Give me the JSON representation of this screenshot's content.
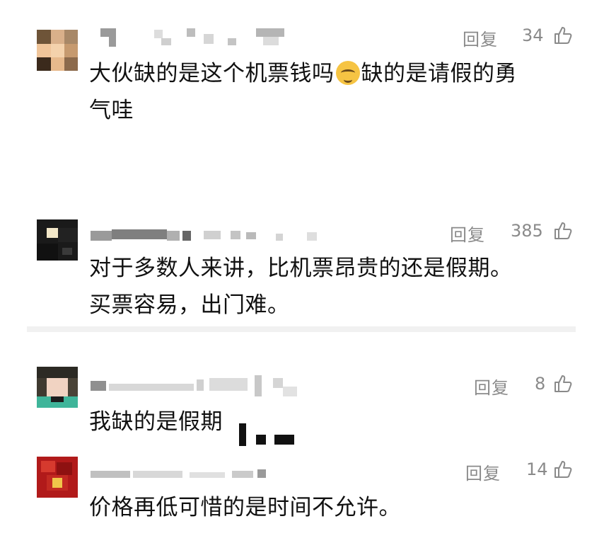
{
  "comments": [
    {
      "reply_label": "回复",
      "likes": "34",
      "lines": [
        "大伙缺的是这个机票钱吗",
        "缺的是请假的勇",
        "气哇"
      ],
      "emoji": "smiling-face-emoji"
    },
    {
      "reply_label": "回复",
      "likes": "385",
      "lines": [
        "对于多数人来讲，比机票昂贵的还是假期。",
        "买票容易，出门难。"
      ]
    },
    {
      "reply_label": "回复",
      "likes": "8",
      "lines": [
        "我缺的是假期"
      ]
    },
    {
      "reply_label": "回复",
      "likes": "14",
      "lines": [
        "价格再低可惜的是时间不允许。"
      ]
    }
  ],
  "colors": {
    "text": "#111111",
    "meta": "#8a8a8a",
    "background": "#ffffff",
    "divider": "#f1f1f1"
  },
  "icons": {
    "like": "thumbs-up-icon"
  }
}
